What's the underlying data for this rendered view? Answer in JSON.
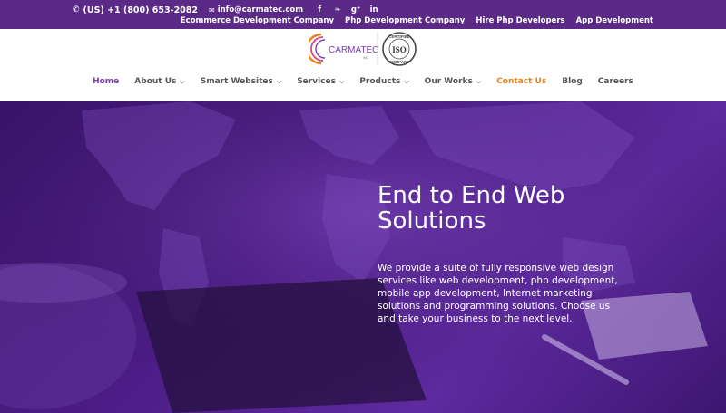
{
  "topbar": {
    "phone": "(US) +1 (800) 653-2082",
    "email": "info@carmatec.com",
    "social": [
      {
        "icon": "facebook-icon",
        "glyph": "f"
      },
      {
        "icon": "twitter-icon",
        "glyph": "❧"
      },
      {
        "icon": "google-plus-icon",
        "glyph": "g⁺"
      },
      {
        "icon": "linkedin-icon",
        "glyph": "in"
      }
    ],
    "links": [
      "Ecommerce Development Company",
      "Php Development Company",
      "Hire Php Developers",
      "App Development"
    ]
  },
  "logo": {
    "brand": "CARMATEC",
    "suffix": "INC",
    "badge_top": "CERTIFIED",
    "badge_mid": "ISO",
    "badge_bottom": "COMPANY"
  },
  "nav": [
    {
      "label": "Home",
      "dropdown": false,
      "state": "active"
    },
    {
      "label": "About Us",
      "dropdown": true,
      "state": ""
    },
    {
      "label": "Smart Websites",
      "dropdown": true,
      "state": ""
    },
    {
      "label": "Services",
      "dropdown": true,
      "state": ""
    },
    {
      "label": "Products",
      "dropdown": true,
      "state": ""
    },
    {
      "label": "Our Works",
      "dropdown": true,
      "state": ""
    },
    {
      "label": "Contact Us",
      "dropdown": false,
      "state": "contact"
    },
    {
      "label": "Blog",
      "dropdown": false,
      "state": ""
    },
    {
      "label": "Careers",
      "dropdown": false,
      "state": ""
    }
  ],
  "hero": {
    "title": "End to End Web Solutions",
    "description": "We provide a suite of fully responsive web design services like web development, php development, mobile app development, Internet marketing solutions and programming solutions. Choose us and take your business to the next level."
  },
  "colors": {
    "topbar_bg": "#5a2a86",
    "nav_active": "#7a3fb0",
    "nav_contact": "#e8831b",
    "hero_bg": "#4c1d86"
  }
}
